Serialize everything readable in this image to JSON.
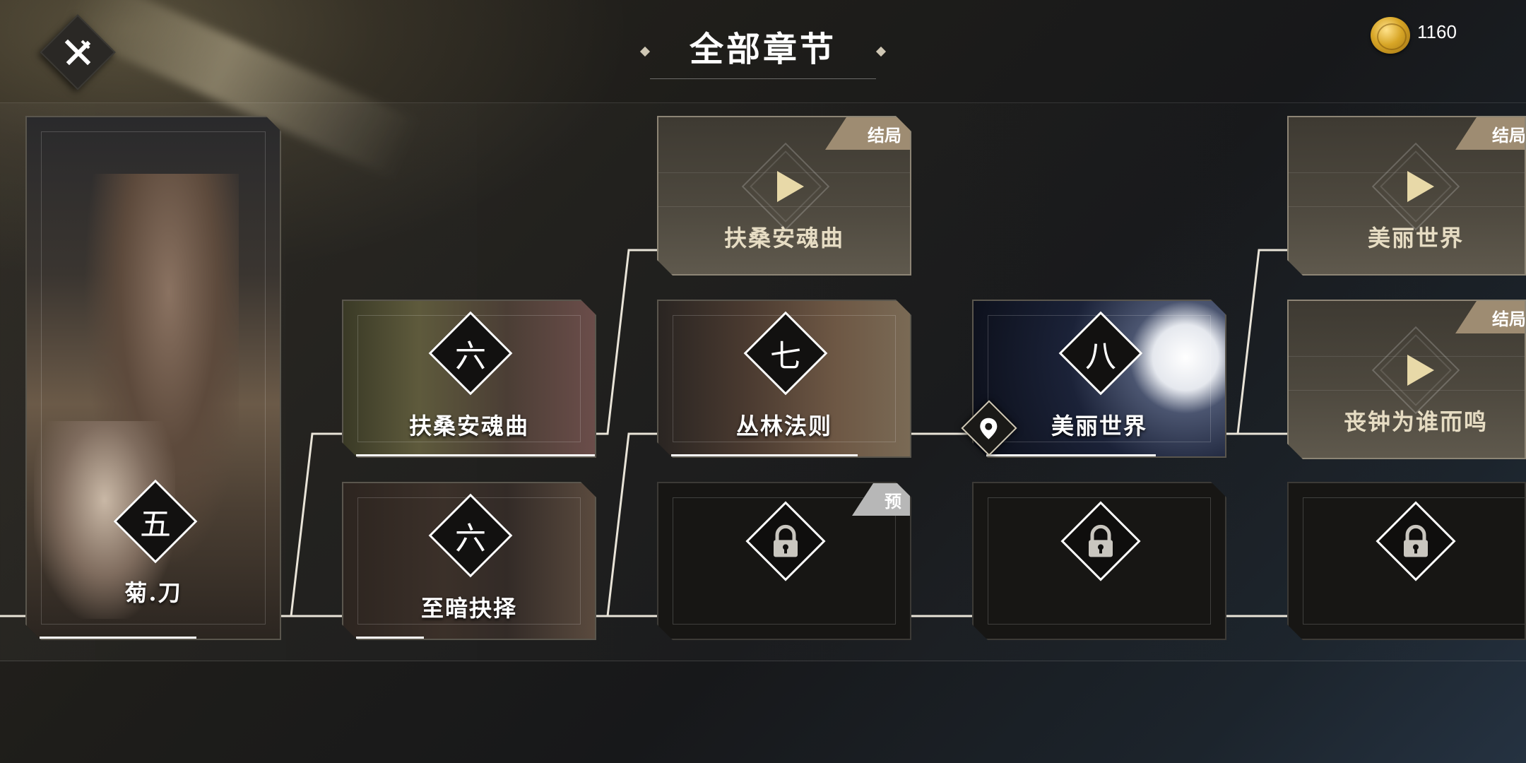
{
  "header": {
    "title": "全部章节",
    "coins": "1160"
  },
  "chapters": {
    "ch5": {
      "number": "五",
      "title": "菊.刀"
    },
    "ch6a": {
      "number": "六",
      "title": "扶桑安魂曲"
    },
    "ch6b": {
      "number": "六",
      "title": "至暗抉择"
    },
    "ch7": {
      "number": "七",
      "title": "丛林法则"
    },
    "ch8": {
      "number": "八",
      "title": "美丽世界"
    }
  },
  "endings": {
    "e1": {
      "tag": "结局",
      "title": "扶桑安魂曲"
    },
    "e2": {
      "tag": "结局",
      "title": "美丽世界"
    },
    "e3": {
      "tag": "结局",
      "title": "丧钟为谁而鸣"
    }
  },
  "locked": {
    "preview_tag": "预"
  },
  "icons": [
    "close-icon",
    "coin-icon",
    "play-icon",
    "lock-icon",
    "location-pin-icon"
  ],
  "colors": {
    "accent": "#9e8c72",
    "preview_tag": "#b7b7b7",
    "coin": "#d7a526"
  }
}
